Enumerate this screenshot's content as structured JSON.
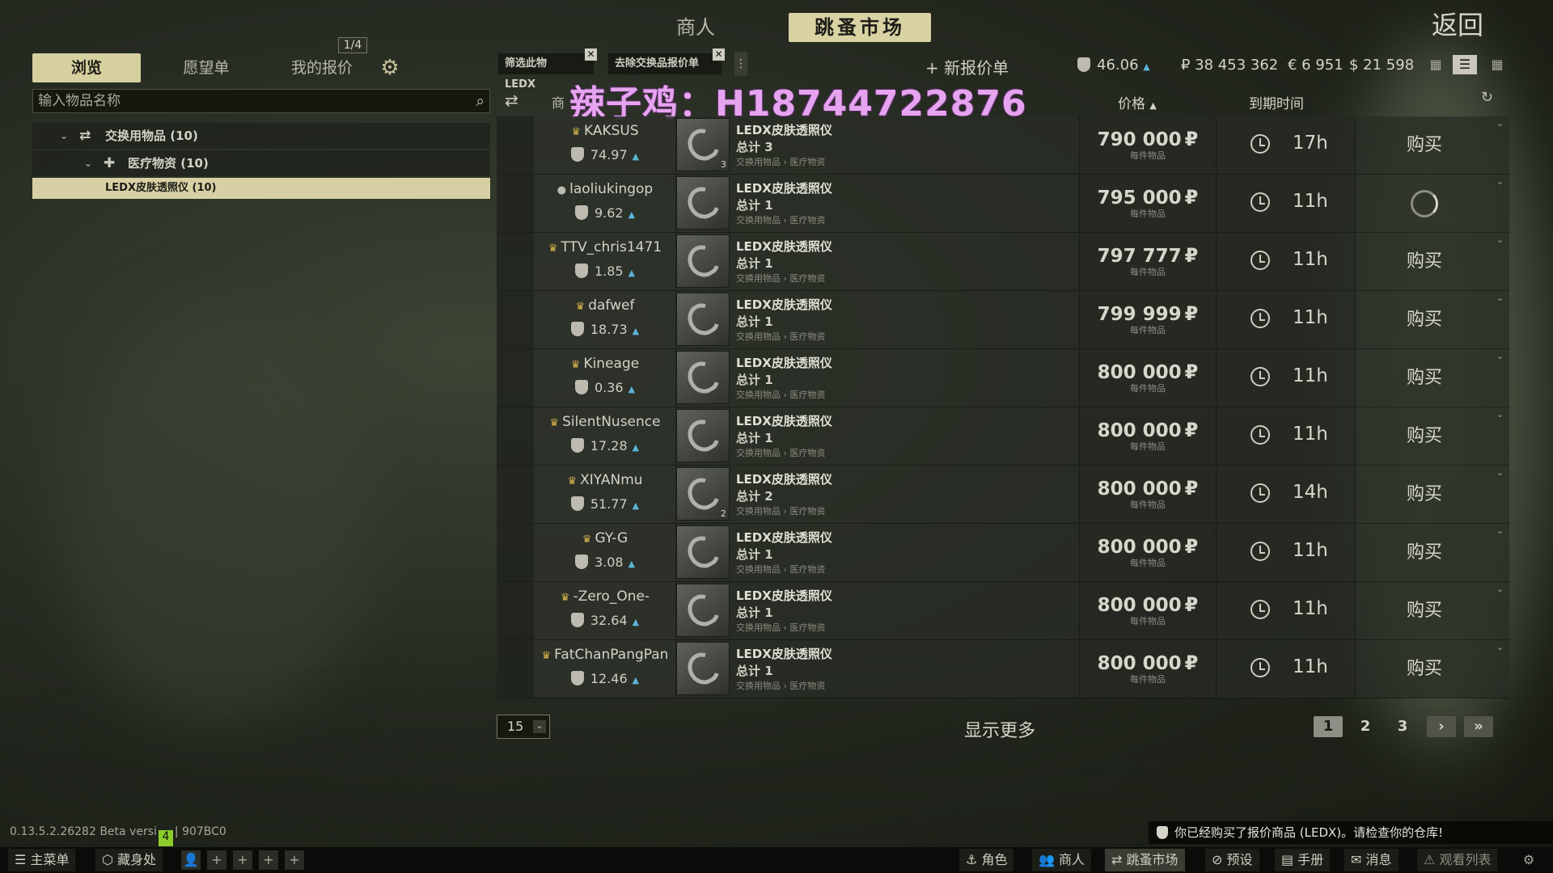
{
  "top": {
    "merchant_tab": "商人",
    "flea_tab": "跳蚤市场",
    "back": "返回"
  },
  "left": {
    "tabs": [
      "浏览",
      "愿望单",
      "我的报价"
    ],
    "page_indicator": "1/4",
    "search_placeholder": "输入物品名称",
    "tree": {
      "root": "交换用物品 (10)",
      "child": "医疗物资 (10)",
      "selected": "LEDX皮肤透照仪 (10)"
    }
  },
  "filters": {
    "chip1": "筛选此物 LEDX",
    "chip2": "去除交换品报价单",
    "new_offer": "+ 新报价单"
  },
  "balances": {
    "reputation": "46.06",
    "rub": "₽ 38 453 362",
    "eur": "€ 6 951",
    "usd": "$ 21 598"
  },
  "table": {
    "col_merchant": "商",
    "col_price": "价格",
    "col_expire": "到期时间"
  },
  "watermark": "辣子鸡：H18744722876",
  "offers": [
    {
      "seller": "KAKSUS",
      "crown": true,
      "rating": "74.97",
      "qty": "3",
      "name": "LEDX皮肤透照仪",
      "total": "总计 3",
      "category": "交换用物品 › 医疗物资",
      "price": "790 000",
      "unit": "每件物品",
      "time": "17h",
      "buy": "购买",
      "loading": false
    },
    {
      "seller": "laoliukingop",
      "crown": false,
      "rating": "9.62",
      "qty": "",
      "name": "LEDX皮肤透照仪",
      "total": "总计 1",
      "category": "交换用物品 › 医疗物资",
      "price": "795 000",
      "unit": "每件物品",
      "time": "11h",
      "buy": "",
      "loading": true
    },
    {
      "seller": "TTV_chris1471",
      "crown": true,
      "rating": "1.85",
      "qty": "",
      "name": "LEDX皮肤透照仪",
      "total": "总计 1",
      "category": "交换用物品 › 医疗物资",
      "price": "797 777",
      "unit": "每件物品",
      "time": "11h",
      "buy": "购买",
      "loading": false
    },
    {
      "seller": "dafwef",
      "crown": true,
      "rating": "18.73",
      "qty": "",
      "name": "LEDX皮肤透照仪",
      "total": "总计 1",
      "category": "交换用物品 › 医疗物资",
      "price": "799 999",
      "unit": "每件物品",
      "time": "11h",
      "buy": "购买",
      "loading": false
    },
    {
      "seller": "Kineage",
      "crown": true,
      "rating": "0.36",
      "qty": "",
      "name": "LEDX皮肤透照仪",
      "total": "总计 1",
      "category": "交换用物品 › 医疗物资",
      "price": "800 000",
      "unit": "每件物品",
      "time": "11h",
      "buy": "购买",
      "loading": false
    },
    {
      "seller": "SilentNusence",
      "crown": true,
      "rating": "17.28",
      "qty": "",
      "name": "LEDX皮肤透照仪",
      "total": "总计 1",
      "category": "交换用物品 › 医疗物资",
      "price": "800 000",
      "unit": "每件物品",
      "time": "11h",
      "buy": "购买",
      "loading": false
    },
    {
      "seller": "XIYANmu",
      "crown": true,
      "rating": "51.77",
      "qty": "2",
      "name": "LEDX皮肤透照仪",
      "total": "总计 2",
      "category": "交换用物品 › 医疗物资",
      "price": "800 000",
      "unit": "每件物品",
      "time": "14h",
      "buy": "购买",
      "loading": false
    },
    {
      "seller": "GY-G",
      "crown": true,
      "rating": "3.08",
      "qty": "",
      "name": "LEDX皮肤透照仪",
      "total": "总计 1",
      "category": "交换用物品 › 医疗物资",
      "price": "800 000",
      "unit": "每件物品",
      "time": "11h",
      "buy": "购买",
      "loading": false
    },
    {
      "seller": "-Zero_One-",
      "crown": true,
      "rating": "32.64",
      "qty": "",
      "name": "LEDX皮肤透照仪",
      "total": "总计 1",
      "category": "交换用物品 › 医疗物资",
      "price": "800 000",
      "unit": "每件物品",
      "time": "11h",
      "buy": "购买",
      "loading": false
    },
    {
      "seller": "FatChanPangPan",
      "crown": true,
      "rating": "12.46",
      "qty": "",
      "name": "LEDX皮肤透照仪",
      "total": "总计 1",
      "category": "交换用物品 › 医疗物资",
      "price": "800 000",
      "unit": "每件物品",
      "time": "11h",
      "buy": "购买",
      "loading": false
    }
  ],
  "footer": {
    "per_page": "15",
    "show_more": "显示更多",
    "pages": [
      "1",
      "2",
      "3"
    ],
    "version_pre": "0.13.5.2.26282 Beta versi",
    "version_badge": "4",
    "version_post": "| 907BC0",
    "notice": "你已经购买了报价商品 (LEDX)。请检查你的仓库!"
  },
  "bottom_bar": {
    "main_menu": "主菜单",
    "hideout": "藏身处",
    "character": "角色",
    "traders": "商人",
    "flea": "跳蚤市场",
    "presets": "预设",
    "handbook": "手册",
    "messages": "消息",
    "watchlist": "观看列表"
  }
}
